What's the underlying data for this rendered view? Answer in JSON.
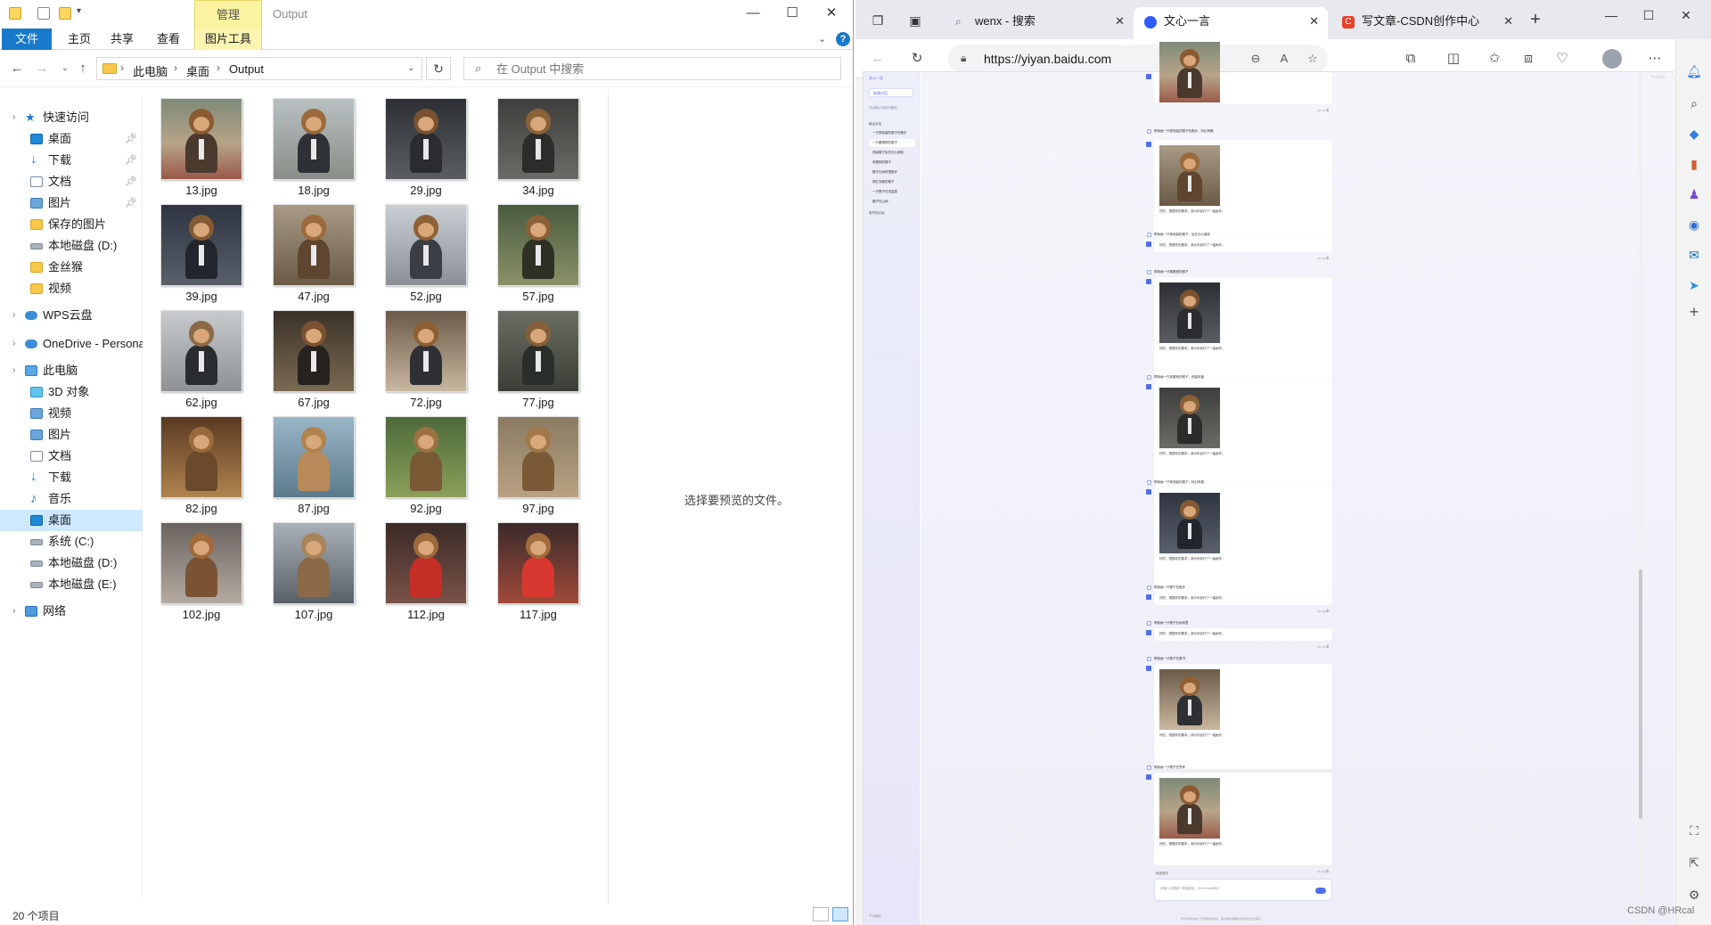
{
  "explorer": {
    "context_tab": "管理",
    "title": "Output",
    "ribbon_tabs": [
      "文件",
      "主页",
      "共享",
      "查看",
      "图片工具"
    ],
    "breadcrumb": [
      "此电脑",
      "桌面",
      "Output"
    ],
    "search_placeholder": "在 Output 中搜索",
    "nav": [
      {
        "label": "快速访问",
        "level": 0,
        "icon": "star-icon"
      },
      {
        "label": "桌面",
        "level": 1,
        "icon": "desktop-icon",
        "pinned": true
      },
      {
        "label": "下载",
        "level": 1,
        "icon": "download-icon",
        "pinned": true
      },
      {
        "label": "文档",
        "level": 1,
        "icon": "document-icon",
        "pinned": true
      },
      {
        "label": "图片",
        "level": 1,
        "icon": "pictures-icon",
        "pinned": true
      },
      {
        "label": "保存的图片",
        "level": 1,
        "icon": "folder-icon"
      },
      {
        "label": "本地磁盘 (D:)",
        "level": 1,
        "icon": "disk-icon"
      },
      {
        "label": "金丝猴",
        "level": 1,
        "icon": "folder-icon"
      },
      {
        "label": "视频",
        "level": 1,
        "icon": "folder-icon"
      },
      {
        "label": "WPS云盘",
        "level": 0,
        "icon": "cloud-icon"
      },
      {
        "label": "OneDrive - Persona",
        "level": 0,
        "icon": "onedrive-icon"
      },
      {
        "label": "此电脑",
        "level": 0,
        "icon": "computer-icon"
      },
      {
        "label": "3D 对象",
        "level": 1,
        "icon": "cube-icon"
      },
      {
        "label": "视频",
        "level": 1,
        "icon": "video-icon"
      },
      {
        "label": "图片",
        "level": 1,
        "icon": "pictures-icon"
      },
      {
        "label": "文档",
        "level": 1,
        "icon": "document-icon"
      },
      {
        "label": "下载",
        "level": 1,
        "icon": "download-icon"
      },
      {
        "label": "音乐",
        "level": 1,
        "icon": "music-icon"
      },
      {
        "label": "桌面",
        "level": 1,
        "icon": "desktop-icon",
        "selected": true
      },
      {
        "label": "系统 (C:)",
        "level": 1,
        "icon": "disk-icon"
      },
      {
        "label": "本地磁盘 (D:)",
        "level": 1,
        "icon": "disk-icon"
      },
      {
        "label": "本地磁盘 (E:)",
        "level": 1,
        "icon": "disk-icon"
      },
      {
        "label": "网络",
        "level": 0,
        "icon": "network-icon"
      }
    ],
    "files": [
      "13.jpg",
      "18.jpg",
      "29.jpg",
      "34.jpg",
      "39.jpg",
      "47.jpg",
      "52.jpg",
      "57.jpg",
      "62.jpg",
      "67.jpg",
      "72.jpg",
      "77.jpg",
      "82.jpg",
      "87.jpg",
      "92.jpg",
      "97.jpg",
      "102.jpg",
      "107.jpg",
      "112.jpg",
      "117.jpg"
    ],
    "preview_text": "选择要预览的文件。",
    "status_count": "20 个项目"
  },
  "edge": {
    "tabs": [
      {
        "label": "wenx - 搜索",
        "icon": "search-icon",
        "color": "#5b6b8c"
      },
      {
        "label": "文心一言",
        "icon": "wenxin-icon",
        "color": "#2e5bff",
        "active": true
      },
      {
        "label": "写文章-CSDN创作中心",
        "icon": "csdn-icon",
        "color": "#e8412c"
      }
    ],
    "url": "https://yiyan.baidu.com",
    "watermark": "CSDN @HRcal"
  },
  "yiyan": {
    "brand": "文心一言",
    "new_chat": "新建对话",
    "hint": "试试输入你的问题吧",
    "history_heading": "最近对话",
    "history": [
      "一只穿西装的猴子在跑步",
      "一只戴眼镜的猴子",
      "西装猴子坐在办公桌前",
      "拿着枪的猴子",
      "猴子在树林里跑步",
      "穿红衣服的猴子",
      "一只猴子在泡温泉",
      "猴子在山间"
    ],
    "history_more": "更早的对话",
    "foot": "个人中心",
    "questions": [
      "帮我画一只穿西装的猴子在跑步，科幻风格",
      "帮我画一只穿西装的猴子，坐在办公桌前",
      "帮我画一只戴眼镜的猴子",
      "帮我画一只拿着枪的猴子，西装风格",
      "帮我画一只穿西装的猴子，科幻风格",
      "帮我画一只猴子在跑步",
      "帮我画一只猴子在树林里",
      "帮我画一只猴子在看书",
      "帮我画一只猴子在思考",
      "帮我画一只穿西装的猴子在森林里跑步"
    ],
    "answer_text": "好的，根据你的要求，我为你创作了一幅画作。",
    "reply_label": "继续提问",
    "input_placeholder": "请输入问题或“/”获取模板，Shift+Enter换行",
    "disclaimer": "所有内容均由人工智能模型输出，其内容的准确性和完整性无法保证"
  }
}
